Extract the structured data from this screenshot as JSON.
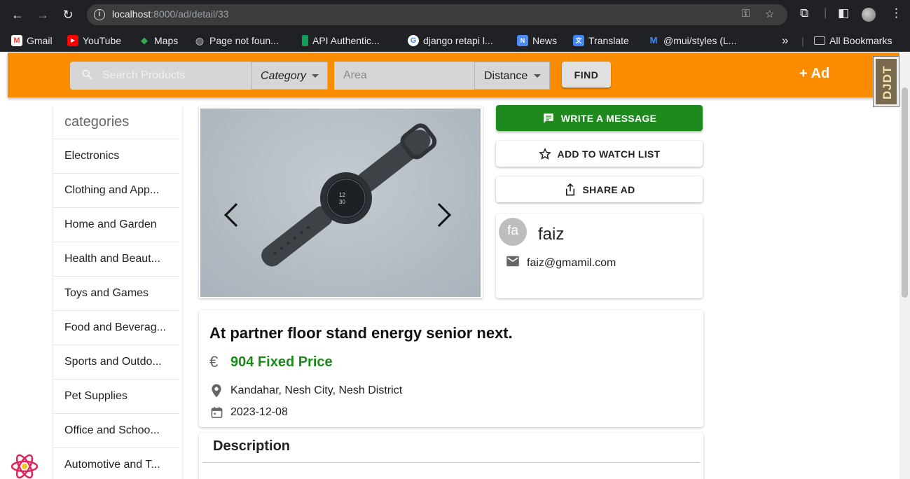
{
  "browser": {
    "url_host": "localhost",
    "url_path": ":8000/ad/detail/33",
    "bookmarks": [
      {
        "label": "Gmail",
        "color": "#ea4335",
        "glyph": "M"
      },
      {
        "label": "YouTube",
        "color": "#ff0000",
        "glyph": "▶"
      },
      {
        "label": "Maps",
        "color": "#34a853",
        "glyph": "◆"
      },
      {
        "label": "Page not foun...",
        "color": "#9aa0a6",
        "glyph": "◍"
      },
      {
        "label": "API Authentic...",
        "color": "#0f9d58",
        "glyph": "▮"
      },
      {
        "label": "django retapi l...",
        "color": "#4285f4",
        "glyph": "G"
      },
      {
        "label": "News",
        "color": "#4c8bf5",
        "glyph": "N"
      },
      {
        "label": "Translate",
        "color": "#4285f4",
        "glyph": "文"
      },
      {
        "label": "@mui/styles (L...",
        "color": "#007fff",
        "glyph": "M"
      }
    ],
    "overflow_label": "»",
    "all_bookmarks_label": "All Bookmarks"
  },
  "header": {
    "search_placeholder": "Search Products",
    "category_label": "Category",
    "area_placeholder": "Area",
    "distance_label": "Distance",
    "find_label": "FIND",
    "add_ad_label": "+ Ad"
  },
  "debug_toolbar": {
    "label": "DJDT"
  },
  "sidebar": {
    "title": "categories",
    "items": [
      "Electronics",
      "Clothing and App...",
      "Home and Garden",
      "Health and Beaut...",
      "Toys and Games",
      "Food and Beverag...",
      "Sports and Outdo...",
      "Pet Supplies",
      "Office and Schoo...",
      "Automotive and T..."
    ]
  },
  "actions": {
    "message_label": "WRITE A MESSAGE",
    "watch_label": "ADD TO WATCH LIST",
    "share_label": "SHARE AD"
  },
  "seller": {
    "initials": "fa",
    "name": "faiz",
    "email": "faiz@gmamil.com"
  },
  "ad": {
    "title": "At partner floor stand energy senior next.",
    "currency_symbol": "€",
    "price": "904 Fixed Price",
    "location": "Kandahar, Nesh City, Nesh District",
    "date": "2023-12-08"
  },
  "description": {
    "title": "Description"
  },
  "colors": {
    "appbar": "#fb8c00",
    "message_button": "#1e8a1e",
    "price": "#1a8a1a"
  }
}
